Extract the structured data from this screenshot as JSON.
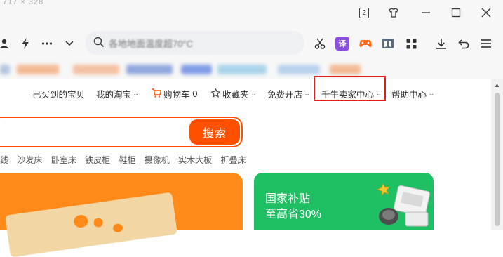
{
  "window": {
    "ghost_text": "717 × 328",
    "tab_count": "2"
  },
  "address_bar": {
    "placeholder": "各地地面温度超70°C"
  },
  "icons": {
    "tb_user": "user-icon",
    "tb_bolt": "lightning-icon",
    "tb_more": "more-icon",
    "tb_chevron": "chevron-down-icon",
    "scissors": "scissors-icon",
    "translate": "translate-icon",
    "game": "gamepad-icon",
    "reader": "reader-icon",
    "apps": "apps-grid-icon",
    "download": "download-icon",
    "undo": "undo-icon",
    "menu": "menu-icon"
  },
  "extensions": {
    "translate_label": "译"
  },
  "topnav": {
    "bought": "已买到的宝贝",
    "my_taobao": "我的淘宝",
    "cart": "购物车",
    "cart_count": "0",
    "favorites": "收藏夹",
    "free_shop": "免费开店",
    "qianniu": "千牛卖家中心",
    "help": "帮助中心"
  },
  "search": {
    "button": "搜索"
  },
  "hotwords": [
    "线",
    "沙发床",
    "卧室床",
    "铁皮柜",
    "鞋柜",
    "摄像机",
    "实木大板",
    "折叠床"
  ],
  "banner": {
    "title": "国家补贴",
    "subtitle": "至高省30%"
  },
  "colors": {
    "brand": "#ff5000",
    "banner_green": "#1fbf63",
    "highlight": "#e02020"
  }
}
